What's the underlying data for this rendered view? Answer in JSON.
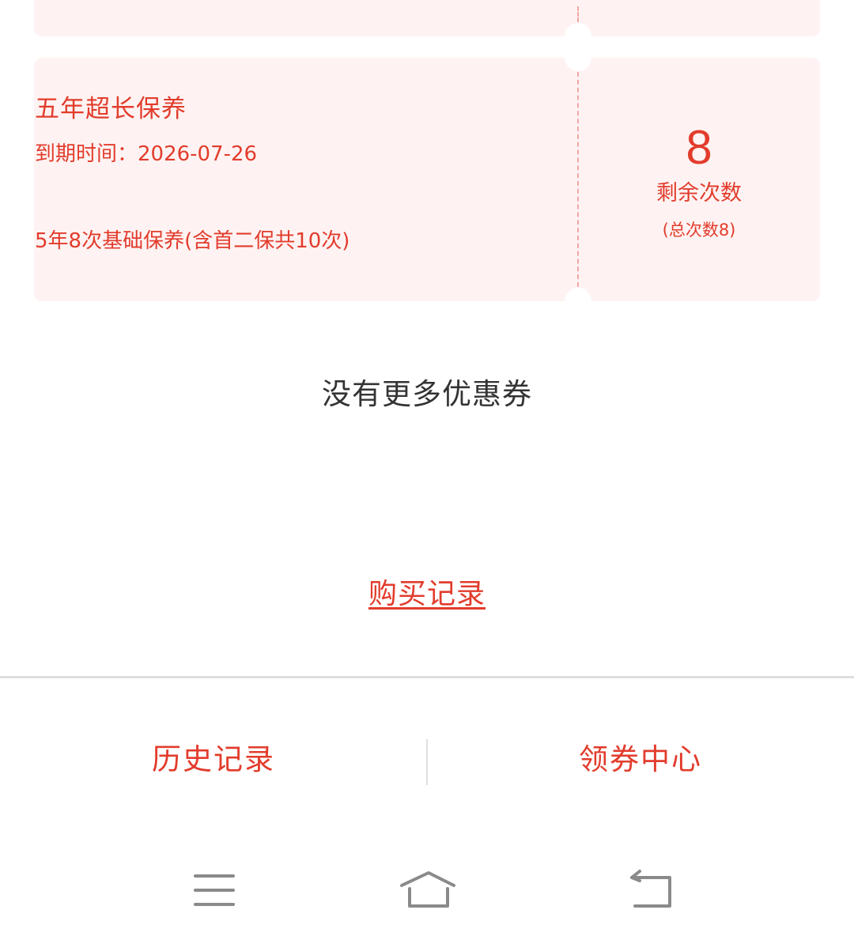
{
  "coupon": {
    "title": "五年超长保养",
    "expire": "到期时间：2026-07-26",
    "description": "5年8次基础保养(含首二保共10次)",
    "remaining_count": "8",
    "remaining_label": "剩余次数",
    "total_label": "(总次数8)"
  },
  "no_more_text": "没有更多优惠券",
  "purchase_record_link": "购买记录",
  "tabbar": {
    "left_label": "历史记录",
    "right_label": "领券中心"
  },
  "system_nav": {
    "menu_icon": "menu-icon",
    "home_icon": "home-icon",
    "back_icon": "back-icon"
  },
  "colors": {
    "accent": "#e23c2c",
    "card_bg": "#fef3f2",
    "text_dark": "#333333"
  }
}
